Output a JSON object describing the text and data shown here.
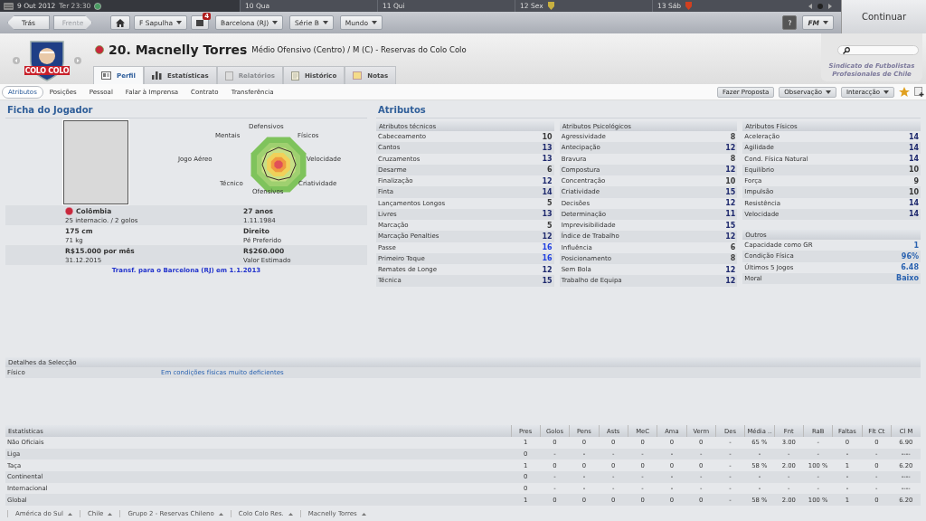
{
  "date_bar": {
    "current_date": "9 Out 2012",
    "current_time": "Ter 23:30",
    "days": [
      "10 Qua",
      "11 Qui",
      "12 Sex",
      "13 Sáb"
    ]
  },
  "continue_button": "Continuar",
  "nav": {
    "back": {
      "label": "Trás",
      "disabled": false
    },
    "forward": {
      "label": "Frente",
      "disabled": true
    },
    "manager_menu": "F Sapulha",
    "inbox_badge": "4",
    "menus": [
      "Barcelona (RJ)",
      "Série B",
      "Mundo"
    ],
    "help": "?",
    "game_menu": "FM"
  },
  "club_crest_text": "COLO COLO",
  "player": {
    "title": "20. Macnelly Torres",
    "subtitle": "Médio Ofensivo (Centro) / M (C) - Reservas do Colo Colo"
  },
  "sponsor": {
    "line_1": "Sindicato de Futbolistas",
    "line_2": "Profesionales de Chile"
  },
  "tabs": [
    {
      "label": "Perfil",
      "selected": true,
      "disabled": false
    },
    {
      "label": "Estatísticas",
      "selected": false,
      "disabled": false
    },
    {
      "label": "Relatórios",
      "selected": false,
      "disabled": true
    },
    {
      "label": "Histórico",
      "selected": false,
      "disabled": false
    },
    {
      "label": "Notas",
      "selected": false,
      "disabled": false
    }
  ],
  "subtabs": [
    {
      "label": "Atributos",
      "selected": true
    },
    {
      "label": "Posições",
      "selected": false
    },
    {
      "label": "Pessoal",
      "selected": false
    },
    {
      "label": "Falar à Imprensa",
      "selected": false
    },
    {
      "label": "Contrato",
      "selected": false
    },
    {
      "label": "Transferência",
      "selected": false
    }
  ],
  "actions": [
    {
      "label": "Fazer Proposta",
      "dropdown": false
    },
    {
      "label": "Observação",
      "dropdown": true
    },
    {
      "label": "Interacção",
      "dropdown": true
    }
  ],
  "profile": {
    "heading": "Ficha do Jogador",
    "radar_labels": [
      "Defensivos",
      "Físicos",
      "Velocidade",
      "Criatividade",
      "Ofensivos",
      "Técnico",
      "Jogo Aéreo",
      "Mentais"
    ],
    "facts": [
      {
        "left_main": "Colômbia",
        "left_sub": "25 internacio. / 2 golos",
        "right_main": "27 anos",
        "right_sub": "1.11.1984"
      },
      {
        "left_main": "175 cm",
        "left_sub": "71 kg",
        "right_main": "Direito",
        "right_sub": "Pé Preferido"
      },
      {
        "left_main": "R$15.000 por mês",
        "left_sub": "31.12.2015",
        "right_main": "R$260.000",
        "right_sub": "Valor Estimado"
      }
    ],
    "transfer_note": "Transf. para o Barcelona (RJ) em 1.1.2013"
  },
  "attributes": {
    "heading": "Atributos",
    "columns": [
      [
        {
          "title": "Atributos técnicos",
          "items": [
            {
              "name": "Cabeceamento",
              "value": "10",
              "color": "#3a3a3a"
            },
            {
              "name": "Cantos",
              "value": "13",
              "color": "#1f2a6e"
            },
            {
              "name": "Cruzamentos",
              "value": "13",
              "color": "#1f2a6e"
            },
            {
              "name": "Desarme",
              "value": "6",
              "color": "#3a3a3a"
            },
            {
              "name": "Finalização",
              "value": "12",
              "color": "#1f2a6e"
            },
            {
              "name": "Finta",
              "value": "14",
              "color": "#1f2a6e"
            },
            {
              "name": "Lançamentos Longos",
              "value": "5",
              "color": "#3a3a3a"
            },
            {
              "name": "Livres",
              "value": "13",
              "color": "#1f2a6e"
            },
            {
              "name": "Marcação",
              "value": "5",
              "color": "#3a3a3a"
            },
            {
              "name": "Marcação Penalties",
              "value": "12",
              "color": "#1f2a6e"
            },
            {
              "name": "Passe",
              "value": "16",
              "color": "#2040e0"
            },
            {
              "name": "Primeiro Toque",
              "value": "16",
              "color": "#2040e0"
            },
            {
              "name": "Remates de Longe",
              "value": "12",
              "color": "#1f2a6e"
            },
            {
              "name": "Técnica",
              "value": "15",
              "color": "#1f2a6e"
            }
          ]
        }
      ],
      [
        {
          "title": "Atributos Psicológicos",
          "items": [
            {
              "name": "Agressividade",
              "value": "8",
              "color": "#3a3a3a"
            },
            {
              "name": "Antecipação",
              "value": "12",
              "color": "#1f2a6e"
            },
            {
              "name": "Bravura",
              "value": "8",
              "color": "#3a3a3a"
            },
            {
              "name": "Compostura",
              "value": "12",
              "color": "#1f2a6e"
            },
            {
              "name": "Concentração",
              "value": "10",
              "color": "#3a3a3a"
            },
            {
              "name": "Criatividade",
              "value": "15",
              "color": "#1f2a6e"
            },
            {
              "name": "Decisões",
              "value": "12",
              "color": "#1f2a6e"
            },
            {
              "name": "Determinação",
              "value": "11",
              "color": "#1f2a6e"
            },
            {
              "name": "Imprevisibilidade",
              "value": "15",
              "color": "#1f2a6e"
            },
            {
              "name": "Índice de Trabalho",
              "value": "12",
              "color": "#1f2a6e"
            },
            {
              "name": "Influência",
              "value": "6",
              "color": "#3a3a3a"
            },
            {
              "name": "Posicionamento",
              "value": "8",
              "color": "#3a3a3a"
            },
            {
              "name": "Sem Bola",
              "value": "12",
              "color": "#1f2a6e"
            },
            {
              "name": "Trabalho de Equipa",
              "value": "12",
              "color": "#1f2a6e"
            }
          ]
        }
      ],
      [
        {
          "title": "Atributos Físicos",
          "items": [
            {
              "name": "Aceleração",
              "value": "14",
              "color": "#1f2a6e"
            },
            {
              "name": "Agilidade",
              "value": "14",
              "color": "#1f2a6e"
            },
            {
              "name": "Cond. Física Natural",
              "value": "14",
              "color": "#1f2a6e"
            },
            {
              "name": "Equilíbrio",
              "value": "10",
              "color": "#3a3a3a"
            },
            {
              "name": "Força",
              "value": "9",
              "color": "#3a3a3a"
            },
            {
              "name": "Impulsão",
              "value": "10",
              "color": "#3a3a3a"
            },
            {
              "name": "Resistência",
              "value": "14",
              "color": "#1f2a6e"
            },
            {
              "name": "Velocidade",
              "value": "14",
              "color": "#1f2a6e"
            }
          ]
        },
        {
          "title": "Outros",
          "items": [
            {
              "name": "Capacidade como GR",
              "value": "1",
              "color": "#2b63b0"
            },
            {
              "name": "Condição Física",
              "value": "96%",
              "color": "#2b63b0"
            },
            {
              "name": "Últimos 5 Jogos",
              "value": "6.48",
              "color": "#2b63b0"
            },
            {
              "name": "Moral",
              "value": "Baixo",
              "color": "#2b63b0"
            }
          ]
        }
      ]
    ]
  },
  "selection": {
    "heading": "Detalhes da Selecção",
    "rows": [
      {
        "label": "Físico",
        "value": "Em condições físicas muito deficientes"
      }
    ]
  },
  "stats": {
    "columns": [
      "Estatísticas",
      "Pres",
      "Golos",
      "Pens",
      "Asts",
      "MeC",
      "Ama",
      "Verm",
      "Des",
      "Média ..",
      "Fnt",
      "RaB",
      "Faltas",
      "Flt Ct",
      "Cl M"
    ],
    "rows": [
      [
        "Não Oficiais",
        "1",
        "0",
        "0",
        "0",
        "0",
        "0",
        "0",
        "-",
        "65 %",
        "3.00",
        "-",
        "0",
        "0",
        "6.90"
      ],
      [
        "Liga",
        "0",
        "-",
        "-",
        "-",
        "-",
        "-",
        "-",
        "-",
        "-",
        "-",
        "-",
        "-",
        "-",
        "----"
      ],
      [
        "Taça",
        "1",
        "0",
        "0",
        "0",
        "0",
        "0",
        "0",
        "-",
        "58 %",
        "2.00",
        "100 %",
        "1",
        "0",
        "6.20"
      ],
      [
        "Continental",
        "0",
        "-",
        "-",
        "-",
        "-",
        "-",
        "-",
        "-",
        "-",
        "-",
        "-",
        "-",
        "-",
        "----"
      ],
      [
        "Internacional",
        "0",
        "-",
        "-",
        "-",
        "-",
        "-",
        "-",
        "-",
        "-",
        "-",
        "-",
        "-",
        "-",
        "----"
      ],
      [
        "Global",
        "1",
        "0",
        "0",
        "0",
        "0",
        "0",
        "0",
        "-",
        "58 %",
        "2.00",
        "100 %",
        "1",
        "0",
        "6.20"
      ]
    ]
  },
  "breadcrumbs": [
    "América do Sul",
    "Chile",
    "Grupo 2 - Reservas Chileno",
    "Colo Colo Res.",
    "Macnelly Torres"
  ]
}
